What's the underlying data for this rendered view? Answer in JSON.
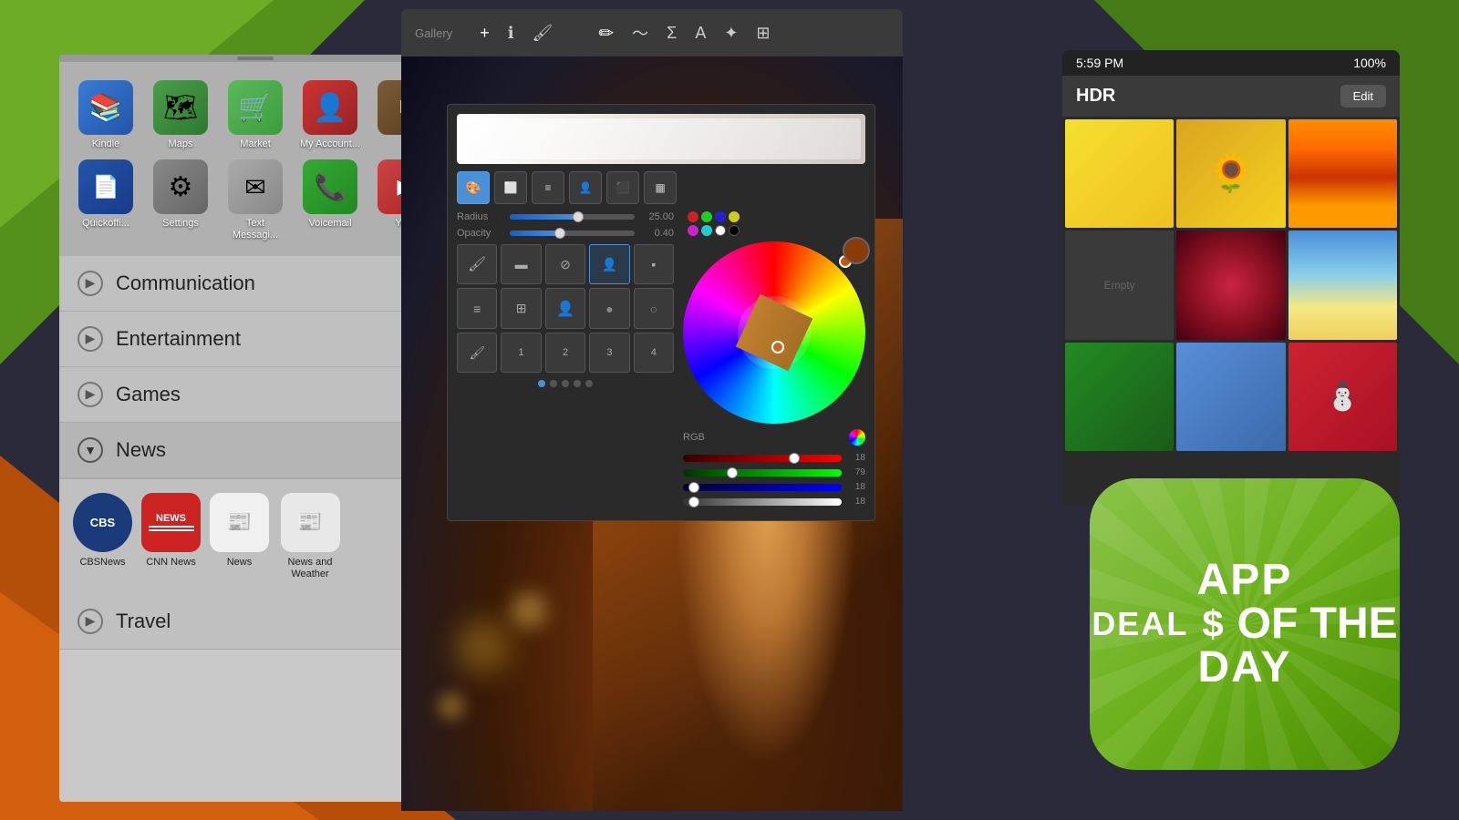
{
  "background": {
    "color": "#2a2a3a"
  },
  "left_panel": {
    "apps": [
      {
        "name": "Kindle",
        "bg": "#3a7bd5",
        "icon": "📚"
      },
      {
        "name": "Maps",
        "bg": "#4a9e4a",
        "icon": "🗺"
      },
      {
        "name": "Market",
        "bg": "#5cb85c",
        "icon": "🛒"
      },
      {
        "name": "My Account...",
        "bg": "#cc3333",
        "icon": "👤"
      },
      {
        "name": "",
        "bg": "#888",
        "icon": ""
      }
    ],
    "apps2": [
      {
        "name": "Quickoffi...",
        "bg": "#2255aa",
        "icon": "📄"
      },
      {
        "name": "Settings",
        "bg": "#777",
        "icon": "⚙"
      },
      {
        "name": "Text Messagi...",
        "bg": "#aaaaaa",
        "icon": "✉"
      },
      {
        "name": "Voicemail",
        "bg": "#33aa33",
        "icon": "📞"
      },
      {
        "name": "Yo...",
        "bg": "#cc4444",
        "icon": ""
      }
    ],
    "categories": [
      {
        "label": "Communication",
        "icon": "▶",
        "expanded": false
      },
      {
        "label": "Entertainment",
        "icon": "▶",
        "expanded": false
      },
      {
        "label": "Games",
        "icon": "▶",
        "expanded": false
      },
      {
        "label": "News",
        "icon": "▼",
        "expanded": true
      },
      {
        "label": "Travel",
        "icon": "▶",
        "expanded": false
      }
    ],
    "news_apps": [
      {
        "name": "CBSNews",
        "bg_color": "#1a3a7a",
        "icon": "CBS"
      },
      {
        "name": "CNN News",
        "bg_color": "#cc2222",
        "icon": "NEWS"
      },
      {
        "name": "News",
        "bg_color": "#e8e8e8",
        "icon": "📰",
        "dark": true
      },
      {
        "name": "News and Weather",
        "bg_color": "#e8e8e8",
        "icon": "📰",
        "dark": true
      }
    ]
  },
  "drawing_app": {
    "toolbar": {
      "gallery_label": "Gallery",
      "icons": [
        "+",
        "ℹ",
        "🖌",
        "✏",
        "∫",
        "Σ",
        "A",
        "✦",
        "⊞"
      ]
    },
    "color_picker": {
      "radius_label": "Radius",
      "opacity_label": "Opacity",
      "radius_value": "25.00",
      "opacity_value": "0.40",
      "rgb_label": "RGB",
      "rgb_r": 18,
      "rgb_g": 79,
      "rgb_b": 18
    }
  },
  "ios_panel": {
    "status_bar": {
      "time": "5:59 PM",
      "battery": "100%"
    },
    "header": {
      "title": "HDR",
      "edit_button": "Edit"
    },
    "empty_label": "Empty",
    "photos": [
      {
        "type": "yellow"
      },
      {
        "type": "sunflower"
      },
      {
        "type": "sunset"
      },
      {
        "type": "empty"
      },
      {
        "type": "flowers"
      },
      {
        "type": "beach"
      },
      {
        "type": "snowman"
      },
      {
        "type": "green"
      },
      {
        "type": "dark"
      }
    ]
  },
  "app_deal": {
    "line1": "APP",
    "dollar": "$",
    "line2": "DEAL",
    "line3": "OF THE",
    "line4": "DAY"
  }
}
